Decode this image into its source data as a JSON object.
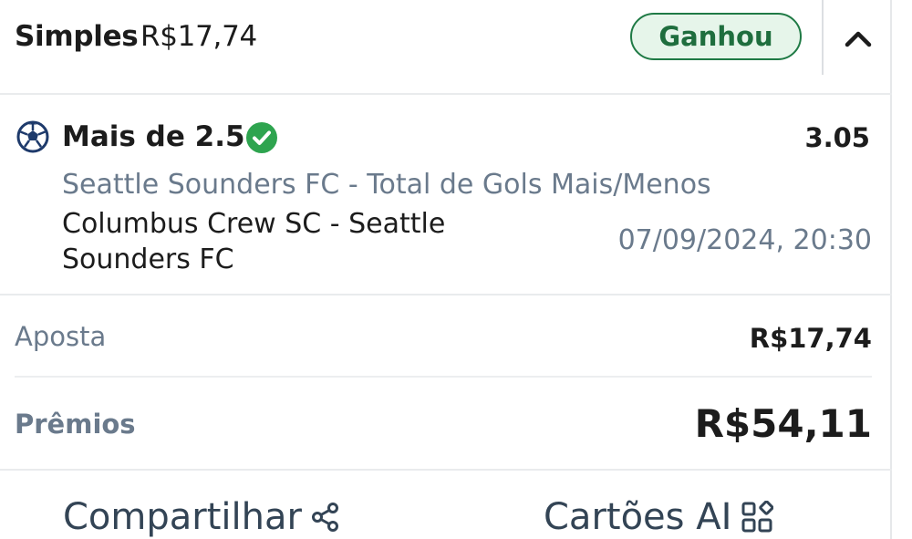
{
  "header": {
    "bet_type": "Simples",
    "stake_amount": "R$17,74",
    "status_badge": "Ganhou"
  },
  "selection": {
    "sport_icon": "soccer-ball-icon",
    "status_icon": "check-circle-icon",
    "market": "Mais de 2.5",
    "odds": "3.05",
    "market_description": "Seattle Sounders FC - Total de Gols Mais/Menos",
    "event_name": "Columbus Crew SC - Seattle Sounders FC",
    "event_datetime": "07/09/2024, 20:30"
  },
  "summary": {
    "stake_label": "Aposta",
    "stake_value": "R$17,74",
    "prize_label": "Prêmios",
    "prize_value": "R$54,11"
  },
  "footer": {
    "share_label": "Compartilhar",
    "share_icon": "share-icon",
    "cards_label": "Cartões AI",
    "cards_icon": "grid-icon"
  },
  "colors": {
    "win_green": "#1f7a45",
    "win_green_bg": "#e6f5ea",
    "muted_text": "#6a7a8c",
    "soccer_icon": "#1e3a6b"
  }
}
